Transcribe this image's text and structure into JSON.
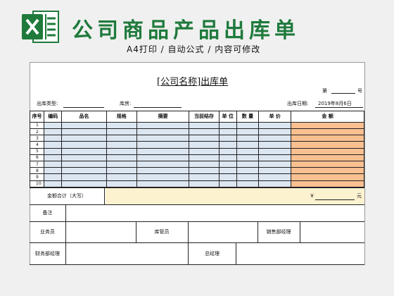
{
  "banner": {
    "title": "公司商品产品出库单",
    "subtitle": "A4打印 / 自动公式 / 内容可修改"
  },
  "sheet": {
    "title_bracket_open": "[",
    "title_company": "公司名称",
    "title_bracket_close": "]",
    "title_suffix": "出库单",
    "no_prefix": "第",
    "no_suffix": "号",
    "type_label": "出库类型:",
    "warehouse_label": "库房:",
    "date_label": "出库日期:",
    "date_value": "2019年8月6日"
  },
  "table": {
    "headers": [
      "序号",
      "编码",
      "品名",
      "规格",
      "摘要",
      "当前结存",
      "单 位",
      "数 量",
      "单 价",
      "金    额"
    ],
    "rows": [
      "1",
      "2",
      "3",
      "4",
      "5",
      "6",
      "7",
      "8",
      "9",
      "10"
    ]
  },
  "total": {
    "label": "金额合计（大写）",
    "currency": "￥",
    "unit": "元"
  },
  "footer": {
    "remark": "备注",
    "salesman": "业务员",
    "keeper": "库管员",
    "sales_manager": "销售部经理",
    "finance_manager": "财务部经理",
    "general_manager": "总经理"
  },
  "colors": {
    "brand_green": "#1f7a3c",
    "row_blue": "#dce6f1",
    "amount_orange": "#fac090",
    "total_fill": "#fdf2d0"
  }
}
